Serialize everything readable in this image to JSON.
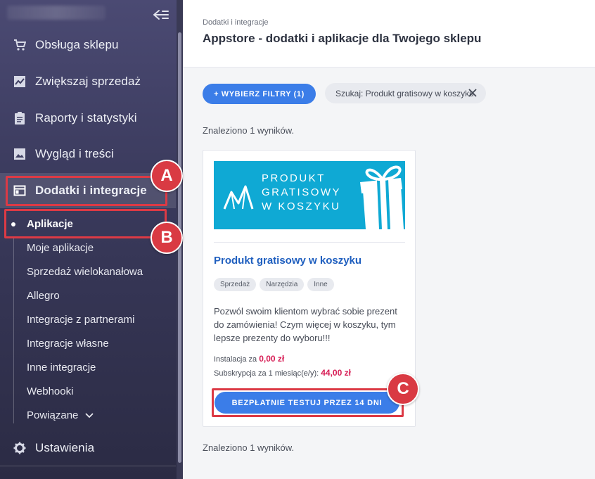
{
  "sidebar": {
    "nav": [
      {
        "label": "Obsługa sklepu",
        "icon": "cart-icon"
      },
      {
        "label": "Zwiększaj sprzedaż",
        "icon": "chart-icon"
      },
      {
        "label": "Raporty i statystyki",
        "icon": "clipboard-icon"
      },
      {
        "label": "Wygląd i treści",
        "icon": "image-icon"
      },
      {
        "label": "Dodatki i integracje",
        "icon": "window-icon"
      }
    ],
    "sub": [
      "Aplikacje",
      "Moje aplikacje",
      "Sprzedaż wielokanałowa",
      "Allegro",
      "Integracje z partnerami",
      "Integracje własne",
      "Inne integracje",
      "Webhooki",
      "Powiązane"
    ],
    "settings": "Ustawienia"
  },
  "header": {
    "breadcrumb": "Dodatki i integracje",
    "title": "Appstore - dodatki i aplikacje dla Twojego sklepu"
  },
  "filters": {
    "button": "+ WYBIERZ FILTRY (1)",
    "chip": "Szukaj: Produkt gratisowy w koszyku"
  },
  "results": {
    "found": "Znaleziono 1 wyników."
  },
  "card": {
    "banner_lines": [
      "PRODUKT",
      "GRATISOWY",
      "W KOSZYKU"
    ],
    "title": "Produkt gratisowy w koszyku",
    "tags": [
      "Sprzedaż",
      "Narzędzia",
      "Inne"
    ],
    "description": "Pozwól swoim klientom wybrać sobie prezent do zamówienia! Czym więcej w koszyku, tym lepsze prezenty do wyboru!!!",
    "install_label": "Instalacja za",
    "install_price": "0,00 zł",
    "sub_label": "Subskrypcja za 1 miesiąc(e/y):",
    "sub_price": "44,00 zł",
    "cta": "BEZPŁATNIE TESTUJ PRZEZ 14 DNI"
  },
  "annotations": {
    "a": "A",
    "b": "B",
    "c": "C"
  },
  "colors": {
    "accent": "#3b7de8",
    "highlight": "#dc3a45",
    "price": "#d71d55",
    "banner": "#0fa9d4"
  }
}
